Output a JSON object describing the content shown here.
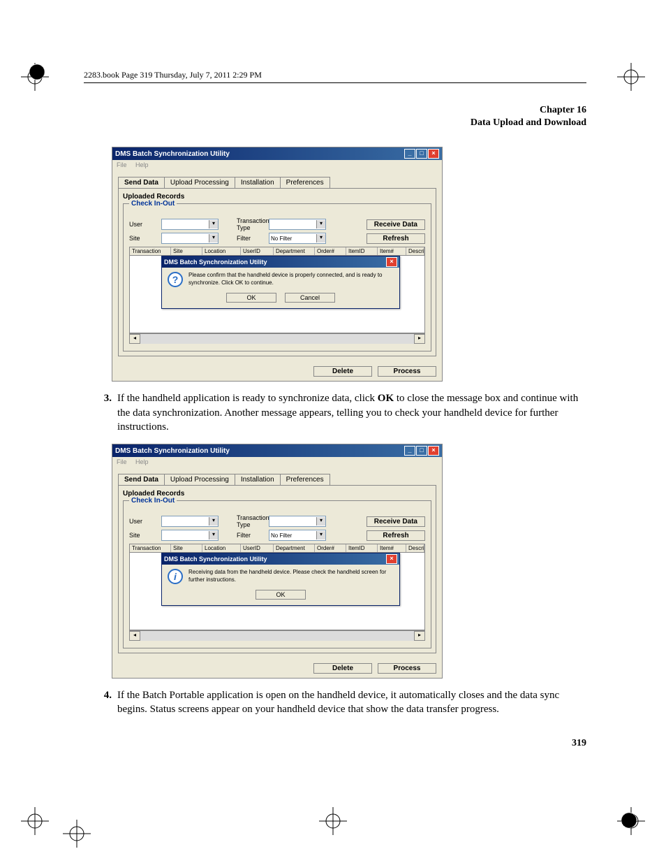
{
  "header_line": "2283.book  Page 319  Thursday, July 7, 2011  2:29 PM",
  "chapter": {
    "line1": "Chapter 16",
    "line2": "Data Upload and Download"
  },
  "screenshot": {
    "title": "DMS Batch Synchronization Utility",
    "menu": {
      "file": "File",
      "help": "Help"
    },
    "tabs": {
      "send": "Send Data",
      "upload": "Upload Processing",
      "install": "Installation",
      "prefs": "Preferences"
    },
    "section": "Uploaded Records",
    "legend": "Check In-Out",
    "labels": {
      "user": "User",
      "site": "Site",
      "ttype": "Transaction Type",
      "filter": "Filter"
    },
    "filter_value": "No Filter",
    "buttons": {
      "receive": "Receive Data",
      "refresh": "Refresh",
      "delete": "Delete",
      "process": "Process"
    },
    "columns": [
      "Transaction",
      "Site",
      "Location",
      "UserID",
      "Department",
      "Order#",
      "ItemID",
      "Item#",
      "Descrip"
    ]
  },
  "dialog1": {
    "title": "DMS Batch Synchronization Utility",
    "text": "Please confirm that the handheld device is properly connected, and is ready to synchronize. Click OK to continue.",
    "ok": "OK",
    "cancel": "Cancel"
  },
  "dialog2": {
    "title": "DMS Batch Synchronization Utility",
    "text": "Receiving data from the handheld device. Please check the handheld screen for further instructions.",
    "ok": "OK"
  },
  "step3": {
    "num": "3.",
    "pre": "If the handheld application is ready to synchronize data, click ",
    "bold": "OK",
    "post": " to close the message box and continue with the data synchronization. Another message appears, telling you to check your handheld device for further instructions."
  },
  "step4": {
    "num": "4.",
    "text": "If the Batch Portable application is open on the handheld device, it automatically closes and the data sync begins. Status screens appear on your handheld device that show the data transfer progress."
  },
  "page_number": "319"
}
